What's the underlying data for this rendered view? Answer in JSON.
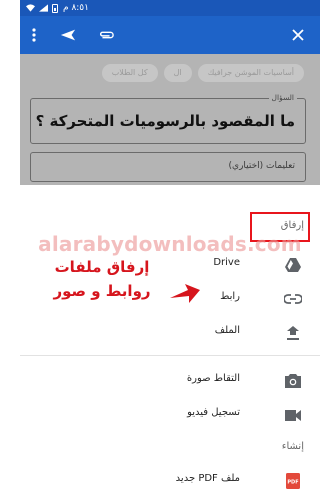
{
  "status_bar": {
    "time": "٨:٥١ م"
  },
  "app_bar": {
    "menu_icon": "more-vert-icon",
    "send_icon": "send-icon",
    "attach_icon": "attach-icon",
    "close_icon": "close-icon"
  },
  "background": {
    "chips": [
      "أساسيات الموشن جرافيك",
      "ال",
      "كل الطلاب"
    ],
    "question_label": "السؤال",
    "question_text": "ما المقصود بالرسوميات المتحركة ؟",
    "instructions_placeholder": "تعليمات (اختياري)"
  },
  "sheet": {
    "attach_title": "إرفاق",
    "attach_items": [
      {
        "label": "Drive",
        "icon": "drive-icon"
      },
      {
        "label": "رابط",
        "icon": "link-icon"
      },
      {
        "label": "الملف",
        "icon": "upload-icon"
      }
    ],
    "create_title": "إنشاء",
    "create_items": [
      {
        "label": "التقاط صورة",
        "icon": "camera-icon"
      },
      {
        "label": "تسجيل فيديو",
        "icon": "video-icon"
      },
      {
        "label": "ملف PDF جديد",
        "icon": "pdf-icon"
      }
    ]
  },
  "annotation": {
    "line1": "إرفاق ملفات",
    "line2": "روابط و صور",
    "color": "#d6151d"
  },
  "watermark": "alarabydownloads.com",
  "colors": {
    "app_bar": "#1e63c8",
    "status_bar": "#1a57b8",
    "highlight": "#e8151c"
  }
}
